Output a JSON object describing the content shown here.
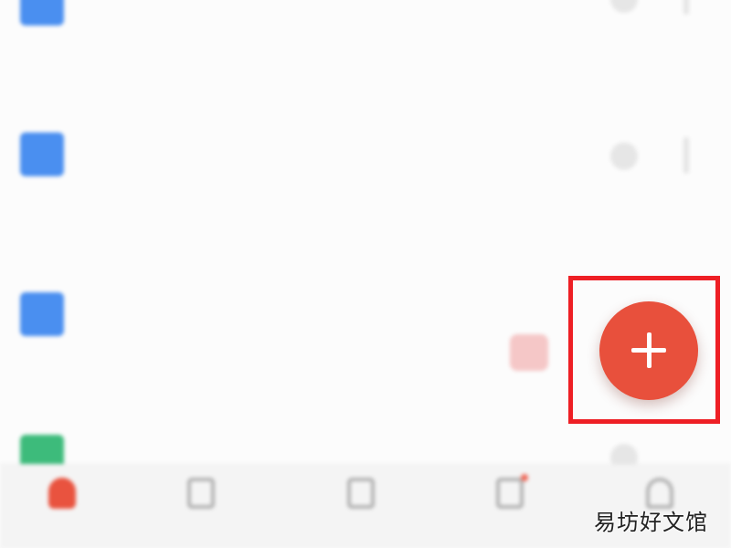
{
  "documents": [
    {
      "icon": "doc-icon",
      "icon_color": "#4a8ff0",
      "title": "",
      "meta": ""
    },
    {
      "icon": "doc-icon",
      "icon_color": "#4a8ff0",
      "title": "",
      "meta": ""
    },
    {
      "icon": "doc-icon",
      "icon_color": "#4a8ff0",
      "title": "",
      "meta": ""
    },
    {
      "icon": "doc-icon",
      "icon_color": "#3dbb7b",
      "title": "",
      "meta": ""
    }
  ],
  "tabbar": {
    "items": [
      {
        "icon": "home-icon",
        "label": "",
        "active": true
      },
      {
        "icon": "clipboard-icon",
        "label": "",
        "active": false
      },
      {
        "icon": "grid-icon",
        "label": "",
        "active": false
      },
      {
        "icon": "message-icon",
        "label": "",
        "active": false
      },
      {
        "icon": "user-icon",
        "label": "",
        "active": false
      }
    ]
  },
  "fab": {
    "icon": "plus-icon",
    "color": "#e8503c"
  },
  "highlight_color": "#ee1f25",
  "watermark": "易坊好文馆"
}
